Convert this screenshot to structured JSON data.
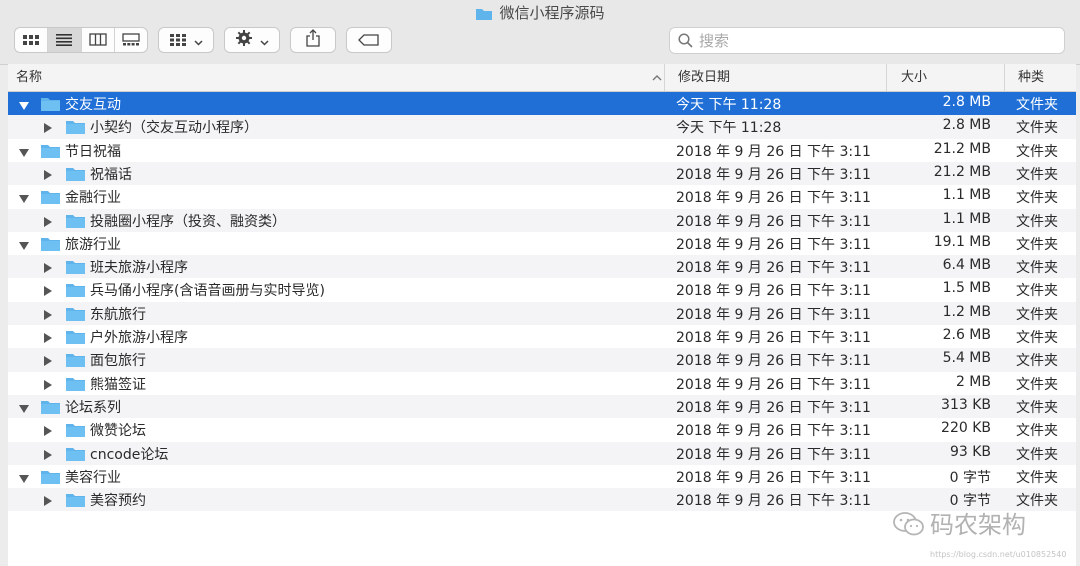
{
  "window": {
    "title": "微信小程序源码"
  },
  "toolbar": {
    "view_icons": [
      "icon-view-icon",
      "list-view-icon",
      "column-view-icon",
      "gallery-view-icon"
    ],
    "search_placeholder": "搜索"
  },
  "columns": {
    "name": "名称",
    "date": "修改日期",
    "size": "大小",
    "kind": "种类"
  },
  "colors": {
    "selection": "#1f6fd6",
    "folder": "#5fb4ec",
    "alt_row": "#f4f4f6"
  },
  "rows": [
    {
      "level": 0,
      "expanded": true,
      "selected": true,
      "name": "交友互动",
      "date": "今天 下午 11:28",
      "size": "2.8 MB",
      "kind": "文件夹"
    },
    {
      "level": 1,
      "expanded": false,
      "selected": false,
      "name": "小契约（交友互动小程序）",
      "date": "今天 下午 11:28",
      "size": "2.8 MB",
      "kind": "文件夹"
    },
    {
      "level": 0,
      "expanded": true,
      "selected": false,
      "name": "节日祝福",
      "date": "2018 年 9 月 26 日 下午 3:11",
      "size": "21.2 MB",
      "kind": "文件夹"
    },
    {
      "level": 1,
      "expanded": false,
      "selected": false,
      "name": "祝福话",
      "date": "2018 年 9 月 26 日 下午 3:11",
      "size": "21.2 MB",
      "kind": "文件夹"
    },
    {
      "level": 0,
      "expanded": true,
      "selected": false,
      "name": "金融行业",
      "date": "2018 年 9 月 26 日 下午 3:11",
      "size": "1.1 MB",
      "kind": "文件夹"
    },
    {
      "level": 1,
      "expanded": false,
      "selected": false,
      "name": "投融圈小程序（投资、融资类）",
      "date": "2018 年 9 月 26 日 下午 3:11",
      "size": "1.1 MB",
      "kind": "文件夹"
    },
    {
      "level": 0,
      "expanded": true,
      "selected": false,
      "name": "旅游行业",
      "date": "2018 年 9 月 26 日 下午 3:11",
      "size": "19.1 MB",
      "kind": "文件夹"
    },
    {
      "level": 1,
      "expanded": false,
      "selected": false,
      "name": "班夫旅游小程序",
      "date": "2018 年 9 月 26 日 下午 3:11",
      "size": "6.4 MB",
      "kind": "文件夹"
    },
    {
      "level": 1,
      "expanded": false,
      "selected": false,
      "name": "兵马俑小程序(含语音画册与实时导览)",
      "date": "2018 年 9 月 26 日 下午 3:11",
      "size": "1.5 MB",
      "kind": "文件夹"
    },
    {
      "level": 1,
      "expanded": false,
      "selected": false,
      "name": "东航旅行",
      "date": "2018 年 9 月 26 日 下午 3:11",
      "size": "1.2 MB",
      "kind": "文件夹"
    },
    {
      "level": 1,
      "expanded": false,
      "selected": false,
      "name": "户外旅游小程序",
      "date": "2018 年 9 月 26 日 下午 3:11",
      "size": "2.6 MB",
      "kind": "文件夹"
    },
    {
      "level": 1,
      "expanded": false,
      "selected": false,
      "name": "面包旅行",
      "date": "2018 年 9 月 26 日 下午 3:11",
      "size": "5.4 MB",
      "kind": "文件夹"
    },
    {
      "level": 1,
      "expanded": false,
      "selected": false,
      "name": "熊猫签证",
      "date": "2018 年 9 月 26 日 下午 3:11",
      "size": "2 MB",
      "kind": "文件夹"
    },
    {
      "level": 0,
      "expanded": true,
      "selected": false,
      "name": "论坛系列",
      "date": "2018 年 9 月 26 日 下午 3:11",
      "size": "313 KB",
      "kind": "文件夹"
    },
    {
      "level": 1,
      "expanded": false,
      "selected": false,
      "name": "微赞论坛",
      "date": "2018 年 9 月 26 日 下午 3:11",
      "size": "220 KB",
      "kind": "文件夹"
    },
    {
      "level": 1,
      "expanded": false,
      "selected": false,
      "name": "cncode论坛",
      "date": "2018 年 9 月 26 日 下午 3:11",
      "size": "93 KB",
      "kind": "文件夹"
    },
    {
      "level": 0,
      "expanded": true,
      "selected": false,
      "name": "美容行业",
      "date": "2018 年 9 月 26 日 下午 3:11",
      "size": "0 字节",
      "kind": "文件夹"
    },
    {
      "level": 1,
      "expanded": false,
      "selected": false,
      "name": "美容预约",
      "date": "2018 年 9 月 26 日 下午 3:11",
      "size": "0 字节",
      "kind": "文件夹"
    }
  ],
  "watermark": {
    "text": "码农架构",
    "url": "https://blog.csdn.net/u010852540"
  }
}
